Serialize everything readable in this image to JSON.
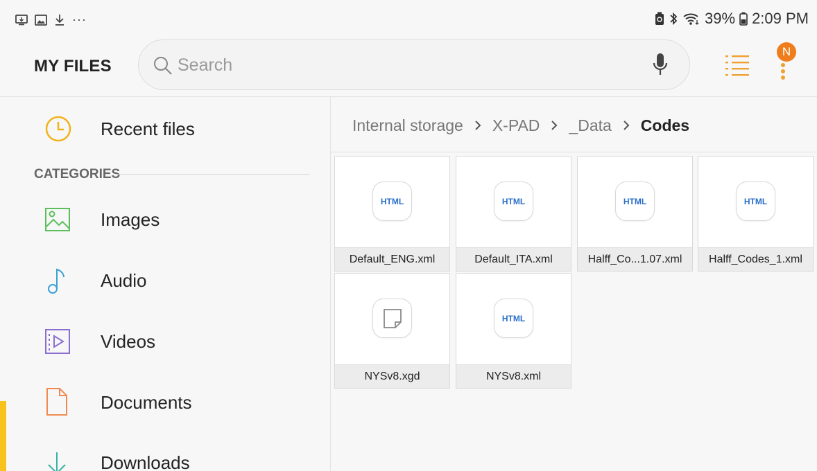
{
  "status_bar": {
    "battery_percent": "39%",
    "time": "2:09 PM",
    "left_icons": [
      "screen-share-icon",
      "image-icon",
      "download-icon",
      "overflow-dots-icon"
    ],
    "left_more": "···"
  },
  "app": {
    "title": "MY FILES",
    "search_placeholder": "Search",
    "avatar_letter": "N",
    "accent_color": "#f07d1c"
  },
  "sidebar": {
    "recent": {
      "label": "Recent files",
      "icon": "clock-icon"
    },
    "categories_label": "CATEGORIES",
    "items": [
      {
        "label": "Images",
        "icon": "image-icon",
        "color": "#5cbf5c"
      },
      {
        "label": "Audio",
        "icon": "music-note-icon",
        "color": "#3aa0d8"
      },
      {
        "label": "Videos",
        "icon": "video-icon",
        "color": "#8b6fd0"
      },
      {
        "label": "Documents",
        "icon": "document-icon",
        "color": "#f08a50"
      },
      {
        "label": "Downloads",
        "icon": "download-arrow-icon",
        "color": "#3bb0a5"
      }
    ]
  },
  "breadcrumb": {
    "parts": [
      "Internal storage",
      "X-PAD",
      "_Data"
    ],
    "current": "Codes",
    "separator": "›"
  },
  "files": [
    {
      "name": "Default_ENG.xml",
      "type": "HTML"
    },
    {
      "name": "Default_ITA.xml",
      "type": "HTML"
    },
    {
      "name": "Halff_Co...1.07.xml",
      "type": "HTML"
    },
    {
      "name": "Halff_Codes_1.xml",
      "type": "HTML"
    },
    {
      "name": "NYSv8.xgd",
      "type": "generic"
    },
    {
      "name": "NYSv8.xml",
      "type": "HTML"
    }
  ]
}
